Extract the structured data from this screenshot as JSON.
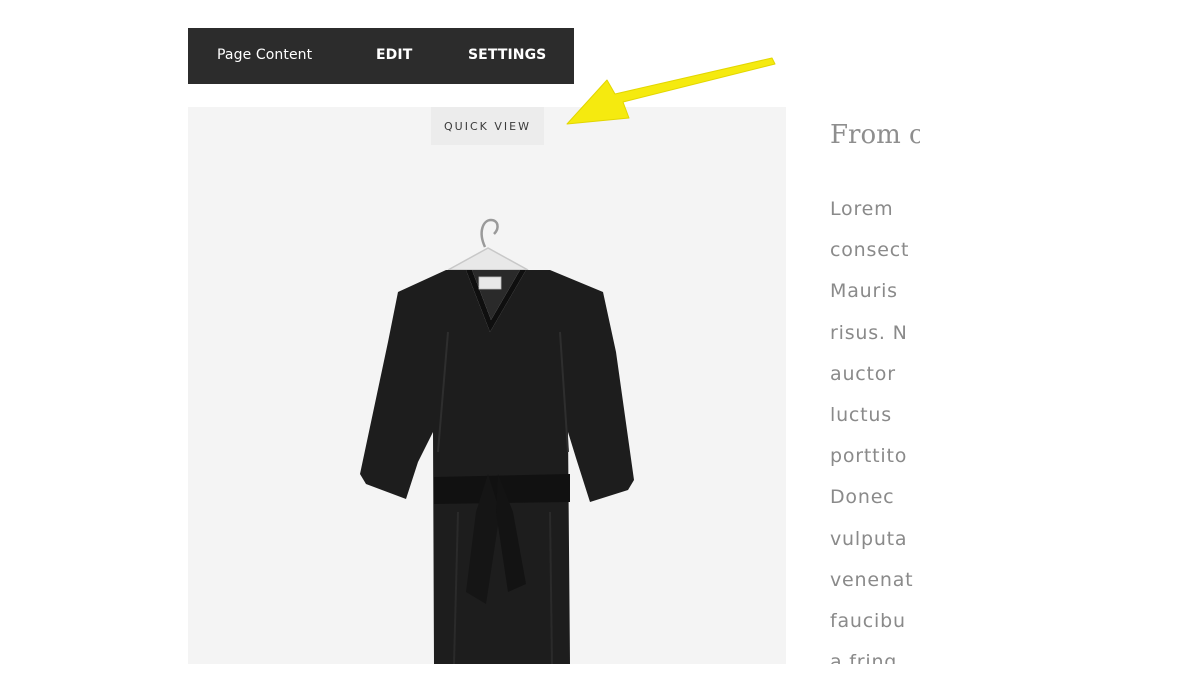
{
  "toolbar": {
    "label": "Page Content",
    "edit": "EDIT",
    "settings": "SETTINGS"
  },
  "product": {
    "quick_view": "QUICK VIEW"
  },
  "text_block": {
    "heading": "From c",
    "lines": [
      "Lorem",
      "consect",
      "Mauris",
      "risus. N",
      "auctor",
      "luctus",
      "porttito",
      "Donec",
      "vulputa",
      "venenat",
      "faucibu",
      "a  fring"
    ]
  },
  "annotation": {
    "arrow_color": "#f5ea0f"
  }
}
